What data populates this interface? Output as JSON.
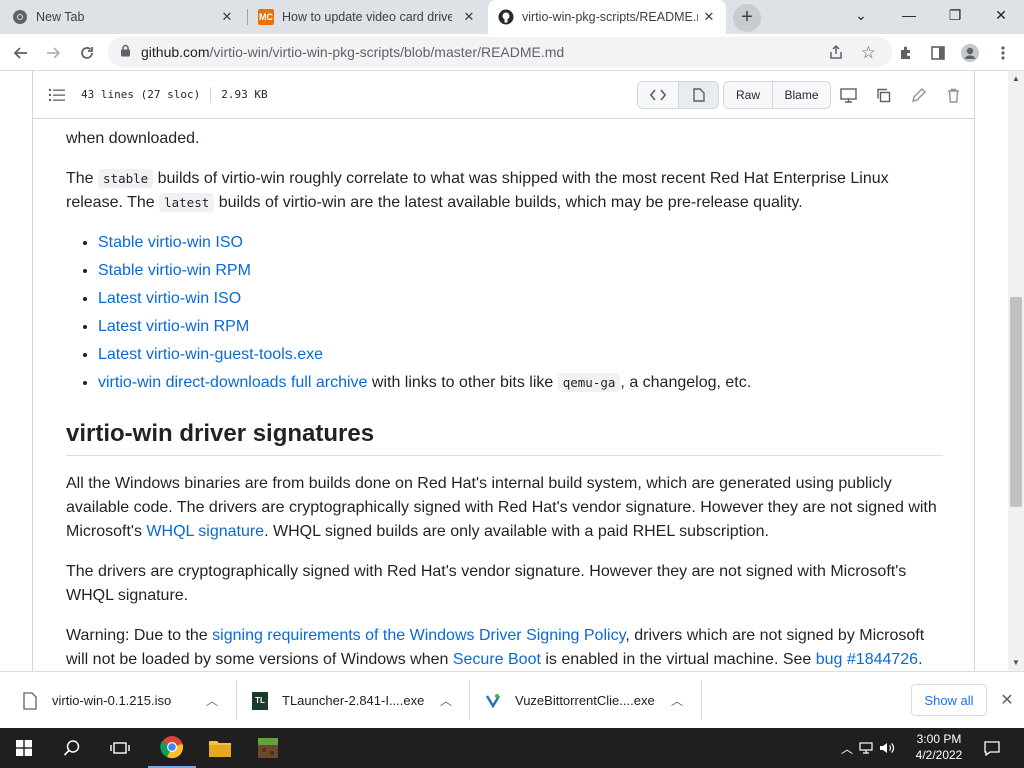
{
  "browser": {
    "tabs": [
      {
        "title": "New Tab",
        "icon": "chrome-icon"
      },
      {
        "title": "How to update video card driver",
        "icon": "makeuseof-icon",
        "icon_text": "MC"
      },
      {
        "title": "virtio-win-pkg-scripts/README.md",
        "icon": "github-icon"
      }
    ],
    "address": {
      "domain": "github.com",
      "path": "/virtio-win/virtio-win-pkg-scripts/blob/master/README.md"
    }
  },
  "file_header": {
    "lines": "43 lines (27 sloc)",
    "size": "2.93 KB",
    "raw_label": "Raw",
    "blame_label": "Blame"
  },
  "readme": {
    "p0_tail": "when downloaded.",
    "p1": {
      "t1": "The ",
      "code1": "stable",
      "t2": " builds of virtio-win roughly correlate to what was shipped with the most recent Red Hat Enterprise Linux release. The ",
      "code2": "latest",
      "t3": " builds of virtio-win are the latest available builds, which may be pre-release quality."
    },
    "links": [
      "Stable virtio-win ISO",
      "Stable virtio-win RPM",
      "Latest virtio-win ISO",
      "Latest virtio-win RPM",
      "Latest virtio-win-guest-tools.exe"
    ],
    "last_item": {
      "link": "virtio-win direct-downloads full archive",
      "t1": " with links to other bits like ",
      "code": "qemu-ga",
      "t2": ", a changelog, etc."
    },
    "h2": "virtio-win driver signatures",
    "p2": {
      "t1": "All the Windows binaries are from builds done on Red Hat's internal build system, which are generated using publicly available code. The drivers are cryptographically signed with Red Hat's vendor signature. However they are not signed with Microsoft's ",
      "link": "WHQL signature",
      "t2": ". WHQL signed builds are only available with a paid RHEL subscription."
    },
    "p3": "The drivers are cryptographically signed with Red Hat's vendor signature. However they are not signed with Microsoft's WHQL signature.",
    "p4": {
      "t1": "Warning: Due to the ",
      "link1": "signing requirements of the Windows Driver Signing Policy",
      "t2": ", drivers which are not signed by Microsoft will not be loaded by some versions of Windows when ",
      "link2": "Secure Boot",
      "t3": " is enabled in the virtual machine. See ",
      "link3": "bug #1844726",
      "t4": "."
    }
  },
  "downloads": {
    "items": [
      {
        "name": "virtio-win-0.1.215.iso"
      },
      {
        "name": "TLauncher-2.841-I....exe",
        "icon_text": "TL"
      },
      {
        "name": "VuzeBittorrentClie....exe"
      }
    ],
    "show_all": "Show all"
  },
  "taskbar": {
    "time": "3:00 PM",
    "date": "4/2/2022"
  },
  "colors": {
    "link": "#0969da",
    "chrome_tab_bg": "#dee1e6",
    "taskbar": "#1f1f1f"
  }
}
